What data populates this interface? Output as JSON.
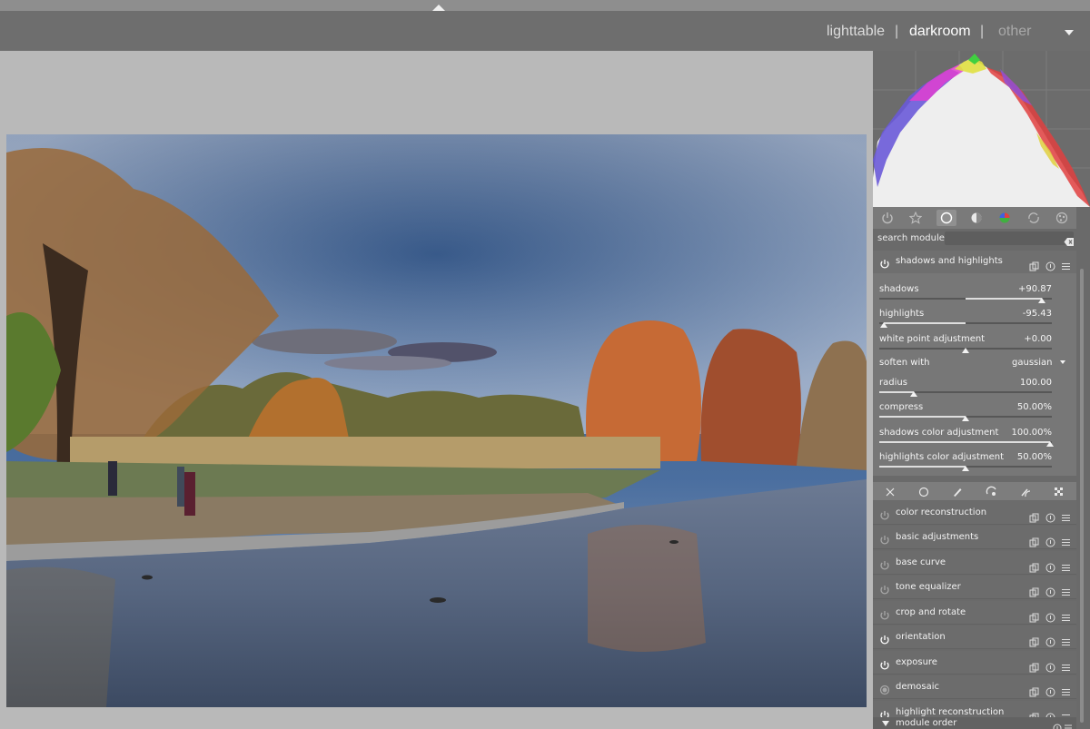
{
  "views": {
    "lighttable": "lighttable",
    "darkroom": "darkroom",
    "other": "other",
    "separator": "|",
    "active": "darkroom"
  },
  "search": {
    "label": "search module",
    "placeholder": ""
  },
  "module_groups": [
    "active-modules-icon",
    "favourites-icon",
    "base-icon",
    "tone-icon",
    "color-icon",
    "correct-icon",
    "effect-icon"
  ],
  "shadows_highlights": {
    "title": "shadows and highlights",
    "sliders": [
      {
        "label": "shadows",
        "value": "+90.87",
        "fraction": 0.94
      },
      {
        "label": "highlights",
        "value": "-95.43",
        "fraction": 0.025
      },
      {
        "label": "white point adjustment",
        "value": "+0.00",
        "fraction": 0.5
      }
    ],
    "soften": {
      "label": "soften with",
      "value": "gaussian"
    },
    "sliders2": [
      {
        "label": "radius",
        "value": "100.00",
        "fraction": 0.2
      },
      {
        "label": "compress",
        "value": "50.00%",
        "fraction": 0.5
      },
      {
        "label": "shadows color adjustment",
        "value": "100.00%",
        "fraction": 1.0
      },
      {
        "label": "highlights color adjustment",
        "value": "50.00%",
        "fraction": 0.5
      }
    ]
  },
  "blend_modes": [
    "off-icon",
    "uniformly-icon",
    "drawn-mask-icon",
    "parametric-mask-icon",
    "drawn-parametric-mask-icon",
    "raster-mask-icon"
  ],
  "modules": [
    {
      "name": "color reconstruction",
      "enabled": false
    },
    {
      "name": "basic adjustments",
      "enabled": false
    },
    {
      "name": "base curve",
      "enabled": false
    },
    {
      "name": "tone equalizer",
      "enabled": false
    },
    {
      "name": "crop and rotate",
      "enabled": false
    },
    {
      "name": "orientation",
      "enabled": true
    },
    {
      "name": "exposure",
      "enabled": true
    },
    {
      "name": "demosaic",
      "enabled": true,
      "always_on": true
    },
    {
      "name": "highlight reconstruction",
      "enabled": true
    }
  ],
  "module_order": {
    "label": "module order"
  },
  "colors": {
    "panel_bg": "#6a6a6a",
    "center_bg": "#b9b9b9",
    "topbar_bg": "#6e6e6e",
    "active_view": "#ffffff"
  }
}
